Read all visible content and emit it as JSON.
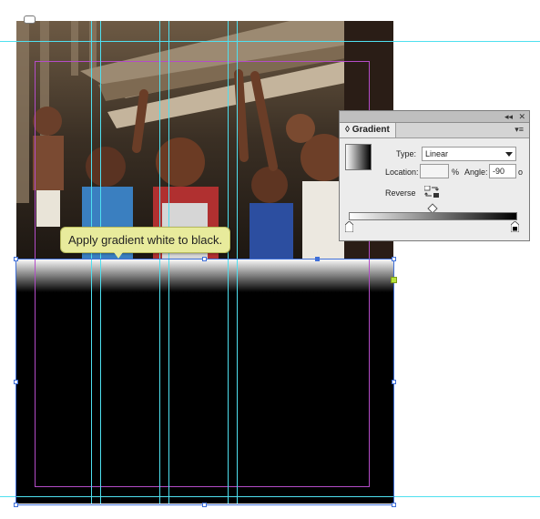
{
  "tooltip": {
    "text": "Apply gradient white to black."
  },
  "gradient_panel": {
    "title": "Gradient",
    "type_label": "Type:",
    "type_value": "Linear",
    "location_label": "Location:",
    "location_value": "",
    "percent_sign": "%",
    "angle_label": "Angle:",
    "angle_value": "-90",
    "degree_sign": "o",
    "reverse_label": "Reverse",
    "collapse_glyph": "◂◂",
    "close_glyph": "✕",
    "menu_glyph": "▾≡",
    "gradient_start_color": "#ffffff",
    "gradient_end_color": "#000000"
  },
  "colors": {
    "guide": "#4fe0f0",
    "margin": "#b44cc8",
    "selection": "#3f6fd8",
    "tooltip_bg": "#e8eb9c"
  }
}
